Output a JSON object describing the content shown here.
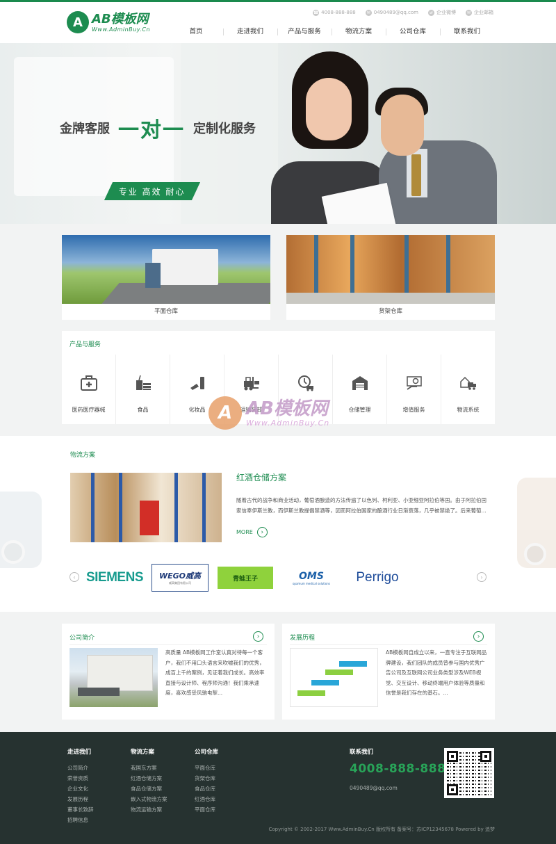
{
  "header": {
    "logo_badge": "A",
    "logo_main": "AB模板网",
    "logo_sub": "Www.AdminBuy.Cn",
    "top_info": [
      {
        "icon": "phone-icon",
        "label": "4008-888-888"
      },
      {
        "icon": "email-icon",
        "label": "0490489@qq.com"
      },
      {
        "icon": "weibo-icon",
        "label": "企业微博"
      },
      {
        "icon": "email-icon",
        "label": "企业邮箱"
      }
    ],
    "nav": [
      "首页",
      "走进我们",
      "产品与服务",
      "物流方案",
      "公司仓库",
      "联系我们"
    ]
  },
  "banner": {
    "slogan_left": "金牌客服",
    "slogan_mid": "一对一",
    "slogan_right": "定制化服务",
    "slogan_bar": "专业 高效 耐心"
  },
  "cards": [
    {
      "caption": "平面仓库"
    },
    {
      "caption": "货架仓库"
    }
  ],
  "products": {
    "title": "产品与服务",
    "items": [
      {
        "label": "医药医疗器械",
        "icon": "medical-kit-icon"
      },
      {
        "label": "食品",
        "icon": "food-icon"
      },
      {
        "label": "化妆品",
        "icon": "cosmetics-icon"
      },
      {
        "label": "运输装卸",
        "icon": "forklift-icon"
      },
      {
        "label": "",
        "icon": "delivery-clock-icon"
      },
      {
        "label": "仓储管理",
        "icon": "warehouse-icon"
      },
      {
        "label": "增值服务",
        "icon": "value-service-icon"
      },
      {
        "label": "物流系统",
        "icon": "logistics-system-icon"
      }
    ]
  },
  "watermark": {
    "badge": "A",
    "main": "AB模板网",
    "sub": "Www.AdminBuy.Cn"
  },
  "logistics": {
    "title": "物流方案",
    "item_title": "红酒仓储方案",
    "item_desc": "随着古代的战争和商业活动，葡萄酒酿造的方法传遍了以色列、柯利亚、小亚细亚阿拉伯等国。由于阿拉伯国家信奉伊斯兰教，而伊斯兰教提倡禁酒等，因而阿拉伯国家的酿酒行业日渐衰落，几乎被禁绝了。后来葡萄...",
    "more": "MORE",
    "brands": {
      "siemens": "SIEMENS",
      "wego_main": "WEGO威高",
      "wego_sub": "威高集团有限公司",
      "green": "青蛙王子",
      "oms_main": "OMS",
      "oms_sub": "opamum medical solutions",
      "perrigo": "Perrigo"
    }
  },
  "about": [
    {
      "title": "公司简介",
      "text": "高质量 AB模板网工作室认真对待每一个客户，我们不用口头语言来吹嘘我们的优秀，成百上千的案例，见证着我们成长。高效率 直接与设计师、程序师沟通！我们乘承速度，喜欢感受风驰电掣..."
    },
    {
      "title": "发展历程",
      "text": "AB模板网自成立以来，一直专注于互联网品牌建设，我们团队的成员曾参与国内优秀广告公司及互联网公司业务类型涉及WEB视觉、交互设计、移动终端用户体验等质量和信誉是我们存在的基石。..."
    }
  ],
  "footer": {
    "cols": [
      {
        "title": "走进我们",
        "items": [
          "公司简介",
          "荣誉资质",
          "企业文化",
          "发展历程",
          "董事长致辞",
          "招聘信息"
        ]
      },
      {
        "title": "物流方案",
        "items": [
          "我国东方案",
          "红酒仓储方案",
          "食品仓储方案",
          "嵌入式物流方案",
          "物流运输方案"
        ]
      },
      {
        "title": "公司仓库",
        "items": [
          "平面仓库",
          "货架仓库",
          "食品仓库",
          "红酒仓库",
          "平面仓库"
        ]
      }
    ],
    "contact_title": "联系我们",
    "phone": "4008-888-888",
    "email": "0490489@qq.com",
    "copyright": "Copyright © 2002-2017 Www.AdminBuy.Cn 版权所有 备案号：苏ICP12345678 Powered by 追梦"
  }
}
